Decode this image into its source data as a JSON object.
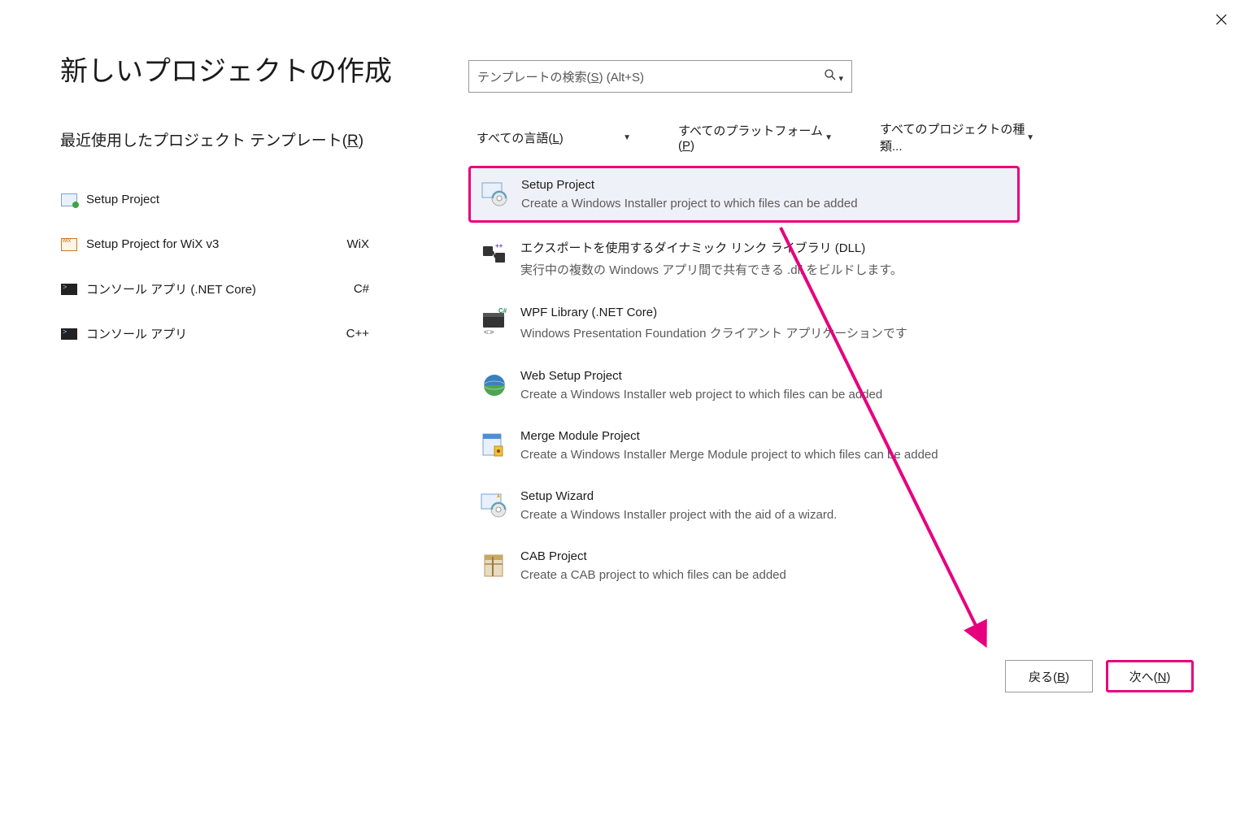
{
  "title": "新しいプロジェクトの作成",
  "search": {
    "placeholder_pre": "テンプレートの検索(",
    "placeholder_u": "S",
    "placeholder_post": ") (Alt+S)"
  },
  "recent": {
    "heading_pre": "最近使用したプロジェクト テンプレート(",
    "heading_u": "R",
    "heading_post": ")",
    "items": [
      {
        "name": "Setup Project",
        "tag": ""
      },
      {
        "name": "Setup Project for WiX v3",
        "tag": "WiX"
      },
      {
        "name": "コンソール アプリ (.NET Core)",
        "tag": "C#"
      },
      {
        "name": "コンソール アプリ",
        "tag": "C++"
      }
    ]
  },
  "filters": {
    "language_pre": "すべての言語(",
    "language_u": "L",
    "language_post": ")",
    "platform_pre": "すべてのプラットフォーム(",
    "platform_u": "P",
    "platform_post": ")",
    "type": "すべてのプロジェクトの種類..."
  },
  "templates": [
    {
      "name": "Setup Project",
      "desc": "Create a Windows Installer project to which files can be added",
      "selected": true
    },
    {
      "name": "エクスポートを使用するダイナミック リンク ライブラリ (DLL)",
      "desc": "実行中の複数の Windows アプリ間で共有できる .dll をビルドします。"
    },
    {
      "name": "WPF Library (.NET Core)",
      "desc": "Windows Presentation Foundation クライアント アプリケーションです"
    },
    {
      "name": "Web Setup Project",
      "desc": "Create a Windows Installer web project to which files can be added"
    },
    {
      "name": "Merge Module Project",
      "desc": "Create a Windows Installer Merge Module project to which files can be added"
    },
    {
      "name": "Setup Wizard",
      "desc": "Create a Windows Installer project with the aid of a wizard."
    },
    {
      "name": "CAB Project",
      "desc": "Create a CAB project to which files can be added"
    }
  ],
  "buttons": {
    "back_pre": "戻る(",
    "back_u": "B",
    "back_post": ")",
    "next_pre": "次へ(",
    "next_u": "N",
    "next_post": ")"
  },
  "colors": {
    "highlight": "#e6007e"
  }
}
